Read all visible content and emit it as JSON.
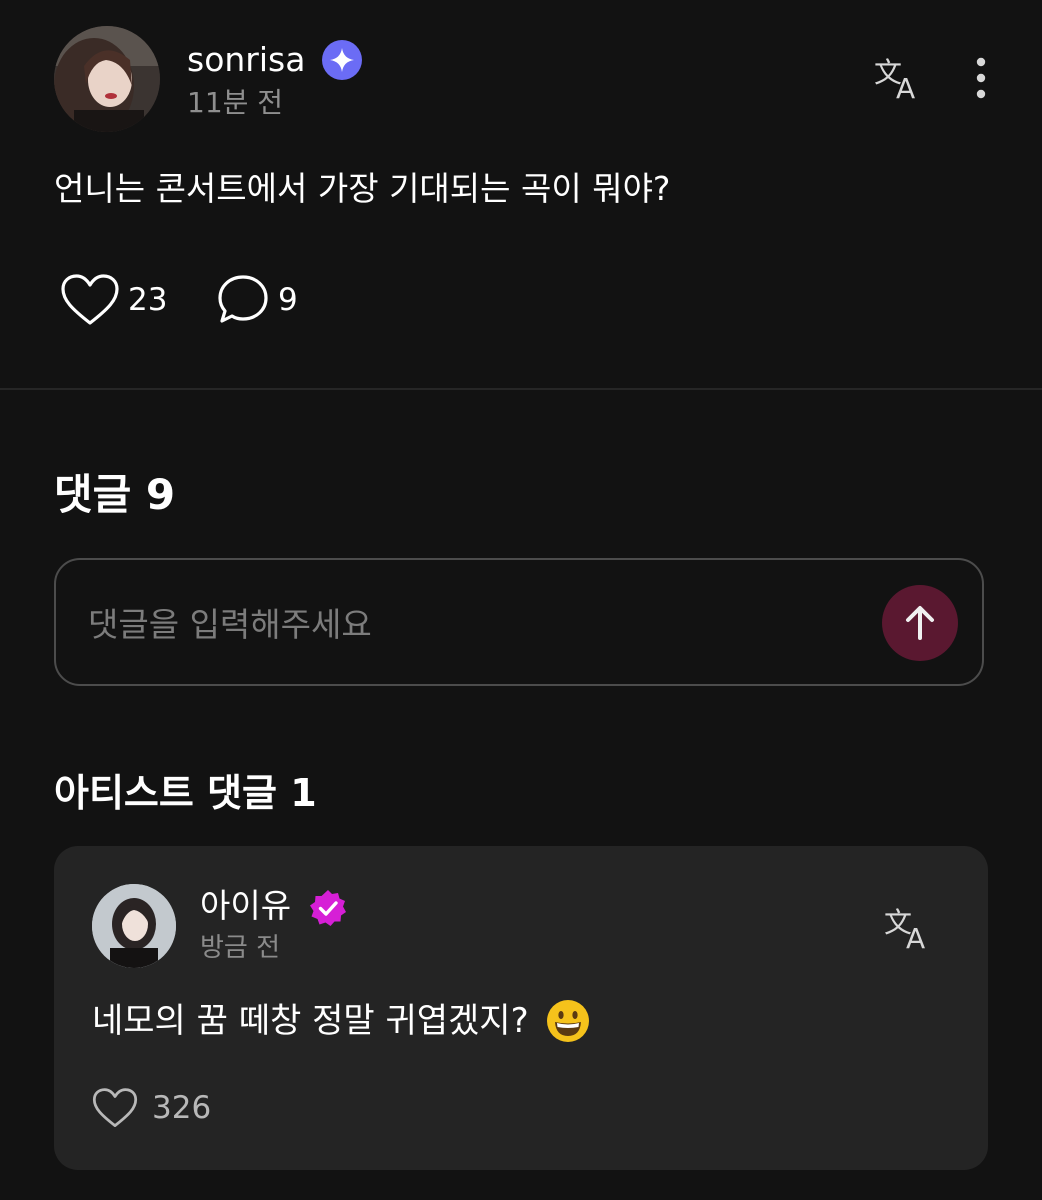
{
  "post": {
    "username": "sonrisa",
    "time": "11분 전",
    "text": "언니는 콘서트에서 가장 기대되는 곡이 뭐야?",
    "likes": "23",
    "comments": "9",
    "verified_badge_color": "#6b6cf5"
  },
  "comments_section": {
    "title": "댓글 9",
    "input_placeholder": "댓글을 입력해주세요",
    "send_button_color": "#5a1830"
  },
  "artist_section": {
    "title": "아티스트 댓글 1",
    "comment": {
      "name": "아이유",
      "time": "방금 전",
      "text": "네모의 꿈 떼창 정말 귀엽겠지?",
      "likes": "326",
      "badge_color": "#d61fd6"
    }
  },
  "icons": {
    "translate": "translate-icon",
    "more": "more-vertical-icon",
    "heart": "heart-icon",
    "comment": "comment-bubble-icon",
    "send": "arrow-up-icon",
    "emoji": "grinning-face-emoji"
  }
}
